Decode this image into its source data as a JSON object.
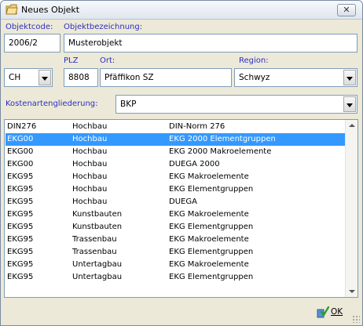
{
  "window": {
    "title": "Neues Objekt",
    "close_label": "✕"
  },
  "labels": {
    "objektcode": "Objektcode:",
    "objektbezeichnung": "Objektbezeichnung:",
    "plz": "PLZ",
    "ort": "Ort:",
    "region": "Region:",
    "kostenartengliederung": "Kostenartengliederung:"
  },
  "fields": {
    "objektcode": "2006/2",
    "objektbezeichnung": "Musterobjekt",
    "country": "CH",
    "plz": "8808",
    "ort": "Pfäffikon SZ",
    "region": "Schwyz",
    "kostenartengliederung": "BKP"
  },
  "list": {
    "selected_index": 1,
    "rows": [
      {
        "c1": "DIN276",
        "c2": "Hochbau",
        "c3": "DIN-Norm 276"
      },
      {
        "c1": "EKG00",
        "c2": "Hochbau",
        "c3": "EKG 2000 Elementgruppen"
      },
      {
        "c1": "EKG00",
        "c2": "Hochbau",
        "c3": "EKG 2000 Makroelemente"
      },
      {
        "c1": "EKG00",
        "c2": "Hochbau",
        "c3": "DUEGA 2000"
      },
      {
        "c1": "EKG95",
        "c2": "Hochbau",
        "c3": "EKG Makroelemente"
      },
      {
        "c1": "EKG95",
        "c2": "Hochbau",
        "c3": "EKG Elementgruppen"
      },
      {
        "c1": "EKG95",
        "c2": "Hochbau",
        "c3": "DUEGA"
      },
      {
        "c1": "EKG95",
        "c2": "Kunstbauten",
        "c3": "EKG Makroelemente"
      },
      {
        "c1": "EKG95",
        "c2": "Kunstbauten",
        "c3": "EKG Elementgruppen"
      },
      {
        "c1": "EKG95",
        "c2": "Trassenbau",
        "c3": "EKG Makroelemente"
      },
      {
        "c1": "EKG95",
        "c2": "Trassenbau",
        "c3": "EKG Elementgruppen"
      },
      {
        "c1": "EKG95",
        "c2": "Untertagbau",
        "c3": "EKG Makroelemente"
      },
      {
        "c1": "EKG95",
        "c2": "Untertagbau",
        "c3": "EKG Elementgruppen"
      }
    ]
  },
  "buttons": {
    "ok": "OK"
  },
  "icons": {
    "title": "folder-icon",
    "ok": "check-icon"
  },
  "colors": {
    "label": "#2b2ec4",
    "selection": "#3399ff"
  }
}
